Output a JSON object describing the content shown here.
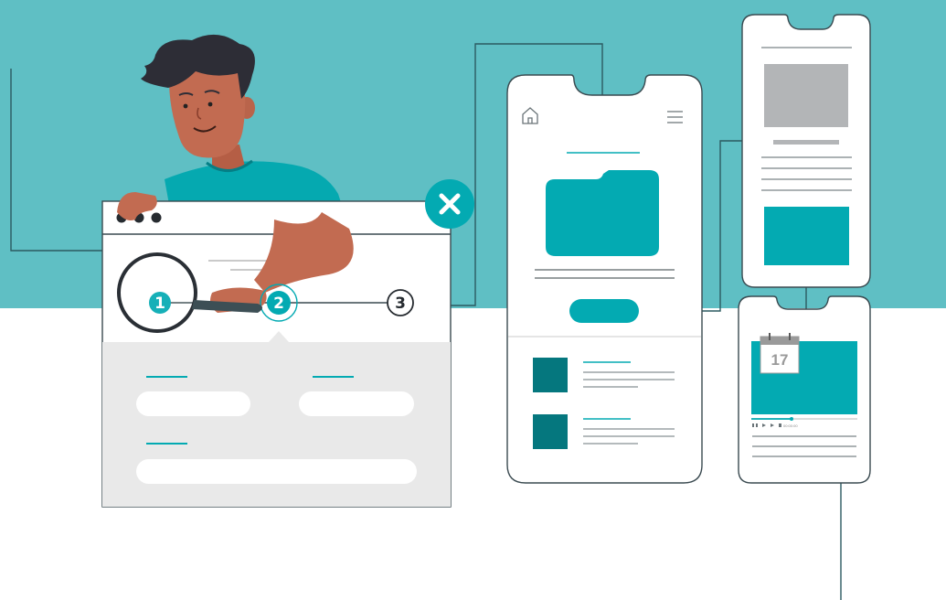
{
  "colors": {
    "band": "#5fbfc4",
    "accent": "#03aab2",
    "dark_teal": "#05777e",
    "line": "#3a4a50",
    "panel": "#e9e9e9",
    "placeholder_gray": "#b3b5b7"
  },
  "wizard": {
    "steps": [
      {
        "label": "1",
        "state": "done"
      },
      {
        "label": "2",
        "state": "current"
      },
      {
        "label": "3",
        "state": "upcoming"
      }
    ],
    "close_icon": "close-icon"
  },
  "phone_main": {
    "icons": [
      "home-icon",
      "hamburger-menu-icon",
      "folder-icon"
    ]
  },
  "phone_video": {
    "calendar_day": "17",
    "player_time": "00:00:00"
  }
}
